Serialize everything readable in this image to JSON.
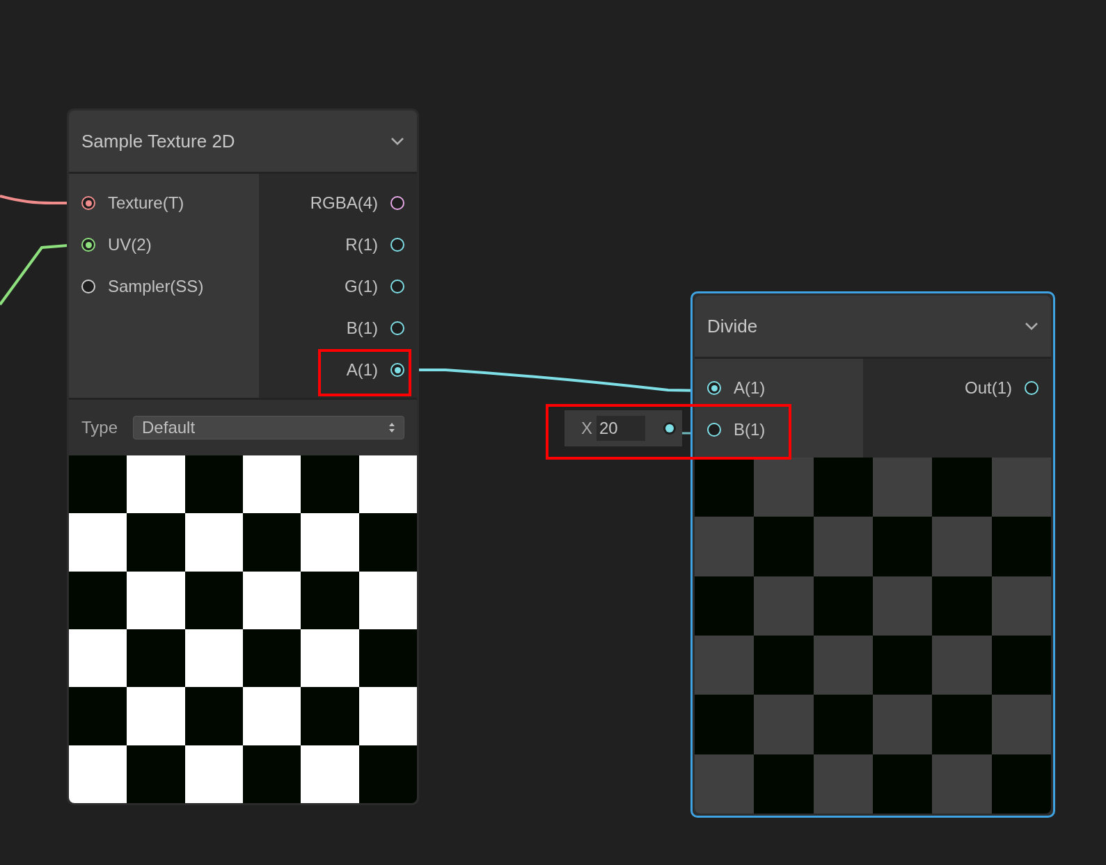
{
  "nodes": [
    {
      "title": "Sample Texture 2D",
      "selected": false,
      "color": "#ffffff",
      "inputs": [
        {
          "label": "Texture(T)",
          "color": "#f08c8c",
          "connected": true,
          "highlighted": false
        },
        {
          "label": "UV(2)",
          "color": "#8ee07e",
          "connected": true,
          "highlighted": false
        },
        {
          "label": "Sampler(SS)",
          "color": "#d0d0d0",
          "connected": false,
          "highlighted": false
        }
      ],
      "outputs": [
        {
          "label": "RGBA(4)",
          "color": "#e6a8e6",
          "connected": false,
          "highlighted": false
        },
        {
          "label": "R(1)",
          "color": "#7fdfe6",
          "connected": false,
          "highlighted": false
        },
        {
          "label": "G(1)",
          "color": "#7fdfe6",
          "connected": false,
          "highlighted": false
        },
        {
          "label": "B(1)",
          "color": "#7fdfe6",
          "connected": false,
          "highlighted": false
        },
        {
          "label": "A(1)",
          "color": "#7fdfe6",
          "connected": true,
          "highlighted": true
        }
      ],
      "controls": [
        {
          "label": "Type",
          "value": "Default"
        }
      ]
    },
    {
      "title": "Divide",
      "selected": true,
      "color": "#404040",
      "inputs": [
        {
          "label": "A(1)",
          "color": "#7fdfe6",
          "connected": true,
          "highlighted": false
        },
        {
          "label": "B(1)",
          "color": "#7fdfe6",
          "connected": false,
          "highlighted": true,
          "inline_field": {
            "label": "X",
            "value": "20"
          }
        }
      ],
      "outputs": [
        {
          "label": "Out(1)",
          "color": "#7fdfe6",
          "connected": false,
          "highlighted": false
        }
      ]
    }
  ]
}
